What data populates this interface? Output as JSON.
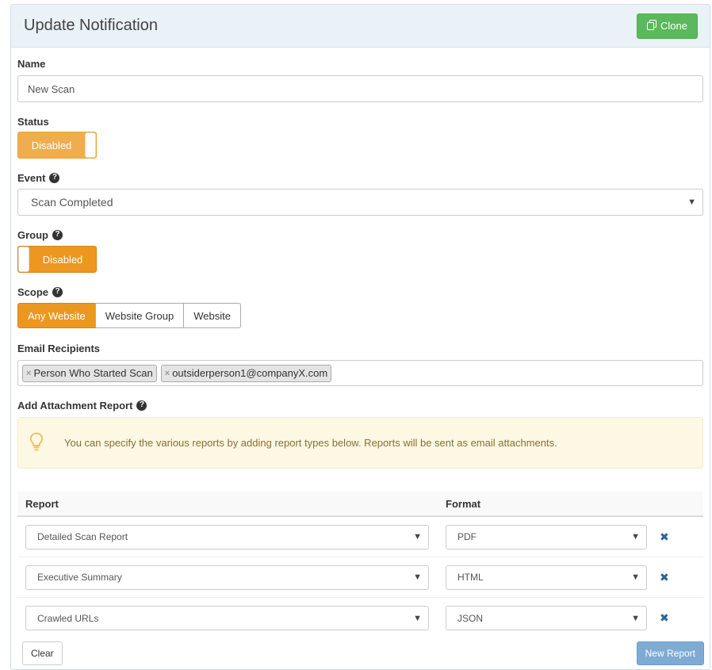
{
  "header": {
    "title": "Update Notification",
    "clone_label": "Clone"
  },
  "name": {
    "label": "Name",
    "value": "New Scan"
  },
  "status": {
    "label": "Status",
    "toggle_label": "Disabled"
  },
  "event": {
    "label": "Event",
    "selected": "Scan Completed"
  },
  "group": {
    "label": "Group",
    "toggle_label": "Disabled"
  },
  "scope": {
    "label": "Scope",
    "options": [
      "Any Website",
      "Website Group",
      "Website"
    ],
    "selected": "Any Website"
  },
  "recipients": {
    "label": "Email Recipients",
    "tags": [
      "Person Who Started Scan",
      "outsiderperson1@companyX.com"
    ]
  },
  "attachments": {
    "label": "Add Attachment Report",
    "info": "You can specify the various reports by adding report types below. Reports will be sent as email attachments.",
    "columns": {
      "report": "Report",
      "format": "Format"
    },
    "rows": [
      {
        "report": "Detailed Scan Report",
        "format": "PDF"
      },
      {
        "report": "Executive Summary",
        "format": "HTML"
      },
      {
        "report": "Crawled URLs",
        "format": "JSON"
      }
    ],
    "clear_label": "Clear",
    "new_label": "New Report"
  },
  "colors": {
    "accent_orange": "#ec971f",
    "status_orange": "#f0ad4e",
    "clone_green": "#5cb85c",
    "new_report_blue": "#7fabd3"
  }
}
